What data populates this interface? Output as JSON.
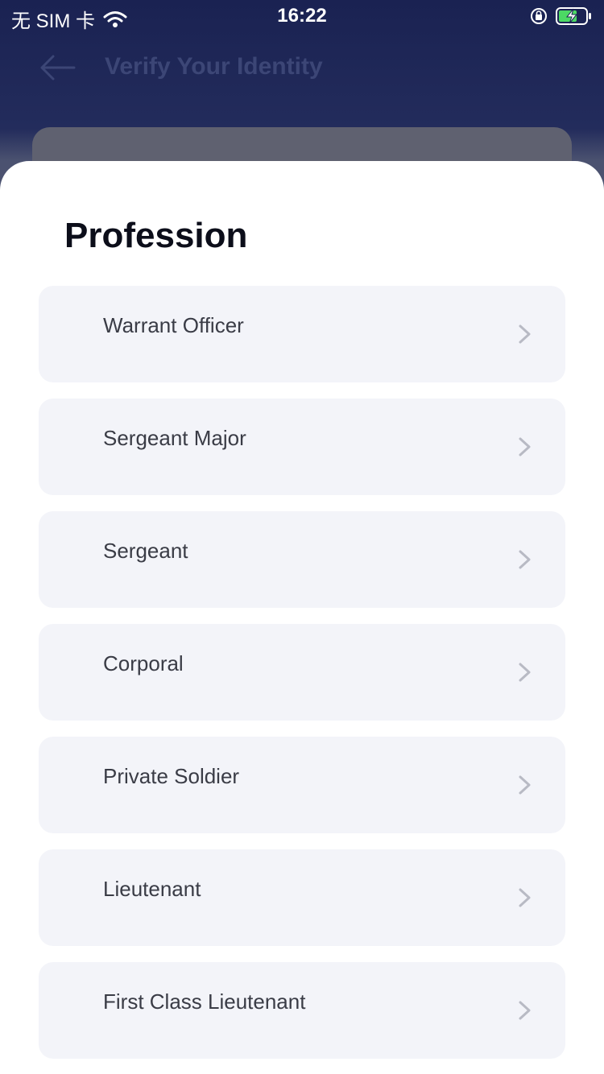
{
  "status_bar": {
    "carrier": "无 SIM 卡",
    "time": "16:22",
    "icons": [
      "wifi-icon",
      "orientation-lock-icon",
      "battery-charging-icon"
    ]
  },
  "nav": {
    "title": "Verify Your Identity",
    "back_icon": "arrow-left-icon"
  },
  "sheet": {
    "title": "Profession",
    "options": [
      {
        "label": "Warrant Officer"
      },
      {
        "label": "Sergeant Major"
      },
      {
        "label": "Sergeant"
      },
      {
        "label": "Corporal"
      },
      {
        "label": "Private Soldier"
      },
      {
        "label": "Lieutenant"
      },
      {
        "label": "First Class Lieutenant"
      }
    ],
    "option_icon": "chevron-right-icon"
  },
  "colors": {
    "header_bg": "#1a2252",
    "sheet_bg": "#ffffff",
    "option_bg": "#f3f4f9",
    "title_text": "#0c0e1a",
    "option_text": "#3a3c46",
    "chevron": "#b8bac4"
  }
}
